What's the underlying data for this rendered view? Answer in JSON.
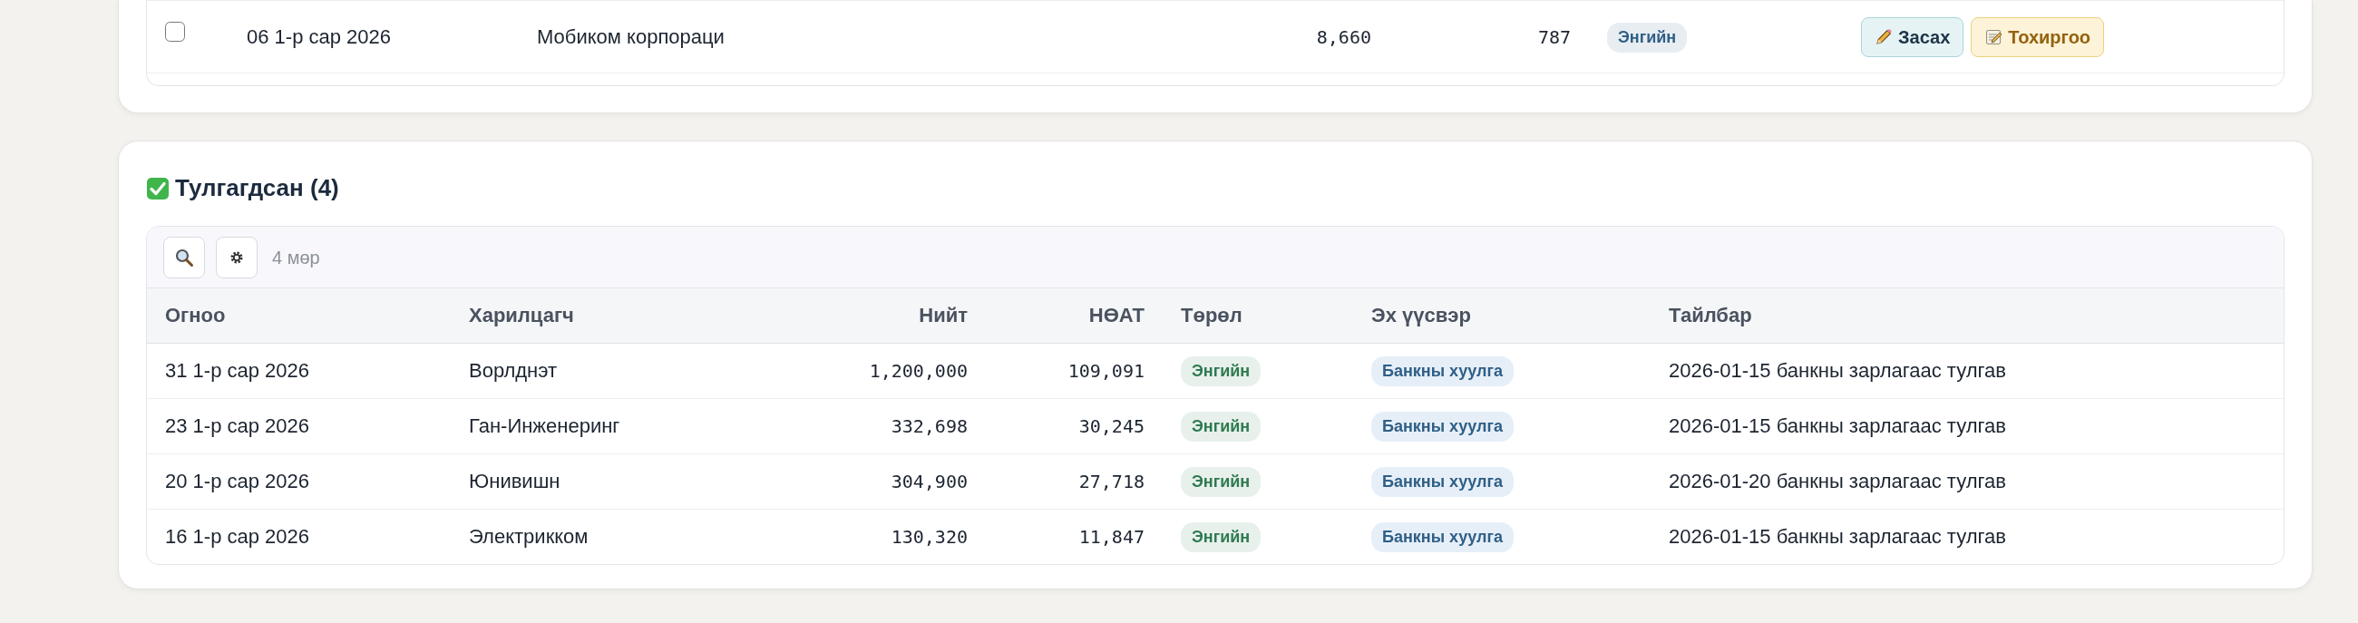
{
  "pending": {
    "rows": [
      {
        "checked": false,
        "date": "06 1-р сар 2026",
        "partner": "Мобиком корпораци",
        "total": "8,660",
        "vat": "787",
        "type": {
          "label": "Энгийн",
          "color": "#2f5f86"
        },
        "actions": [
          {
            "label": "Засах",
            "kind": "edit"
          },
          {
            "label": "Тохиргоо",
            "kind": "settings"
          }
        ]
      }
    ]
  },
  "confirmed": {
    "title": "Тулгагдсан (4)",
    "toolbar": {
      "row_count": "4 мөр"
    },
    "columns": [
      "Огноо",
      "Харилцагч",
      "Нийт",
      "НӨАТ",
      "Төрөл",
      "Эх үүсвэр",
      "Тайлбар"
    ],
    "rows": [
      {
        "date": "31 1-р сар 2026",
        "partner": "Ворлднэт",
        "total": "1,200,000",
        "vat": "109,091",
        "type": {
          "label": "Энгийн",
          "color": "#2d7a4f"
        },
        "source": "Банкны хуулга",
        "note": "2026-01-15 банкны зарлагаас тулгав"
      },
      {
        "date": "23 1-р сар 2026",
        "partner": "Ган-Инженеринг",
        "total": "332,698",
        "vat": "30,245",
        "type": {
          "label": "Энгийн",
          "color": "#2d7a4f"
        },
        "source": "Банкны хуулга",
        "note": "2026-01-15 банкны зарлагаас тулгав"
      },
      {
        "date": "20 1-р сар 2026",
        "partner": "Юнивишн",
        "total": "304,900",
        "vat": "27,718",
        "type": {
          "label": "Энгийн",
          "color": "#2d7a4f"
        },
        "source": "Банкны хуулга",
        "note": "2026-01-20 банкны зарлагаас тулгав"
      },
      {
        "date": "16 1-р сар 2026",
        "partner": "Электрикком",
        "total": "130,320",
        "vat": "11,847",
        "type": {
          "label": "Энгийн",
          "color": "#2d7a4f"
        },
        "source": "Банкны хуулга",
        "note": "2026-01-15 банкны зарлагаас тулгав"
      }
    ]
  }
}
